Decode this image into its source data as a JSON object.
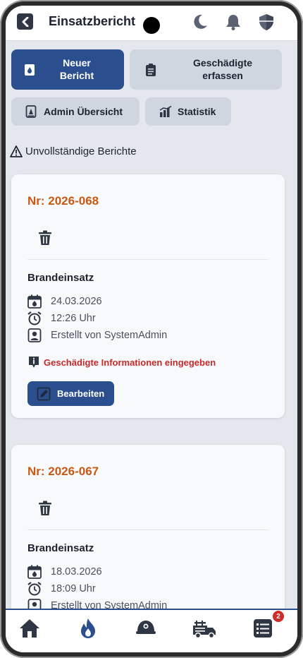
{
  "header": {
    "title": "Einsatzbericht",
    "icons": [
      "back-icon",
      "moon-icon",
      "bell-icon",
      "shield-icon"
    ]
  },
  "actions": {
    "new_report": "Neuer Bericht",
    "capture_victims": "Geschädigte erfassen",
    "admin_overview": "Admin Übersicht",
    "statistics": "Statistik"
  },
  "warning_text": "Unvollständige Berichte",
  "reports": [
    {
      "nr": "Nr: 2026-068",
      "type": "Brandeinsatz",
      "date": "24.03.2026",
      "time": "12:26 Uhr",
      "created_by": "Erstellt von SystemAdmin",
      "info": "Geschädigte Informationen eingegeben",
      "edit_label": "Bearbeiten"
    },
    {
      "nr": "Nr: 2026-067",
      "type": "Brandeinsatz",
      "date": "18.03.2026",
      "time": "18:09 Uhr",
      "created_by": "Erstellt von SystemAdmin"
    }
  ],
  "bottom_nav": {
    "items": [
      "home-icon",
      "fire-icon",
      "firefighter-helmet-icon",
      "fire-truck-icon",
      "list-icon"
    ],
    "list_badge": "2"
  },
  "colors": {
    "primary": "#2b4f8e",
    "accent_orange": "#c65a14",
    "alert_red": "#c42a2a"
  }
}
